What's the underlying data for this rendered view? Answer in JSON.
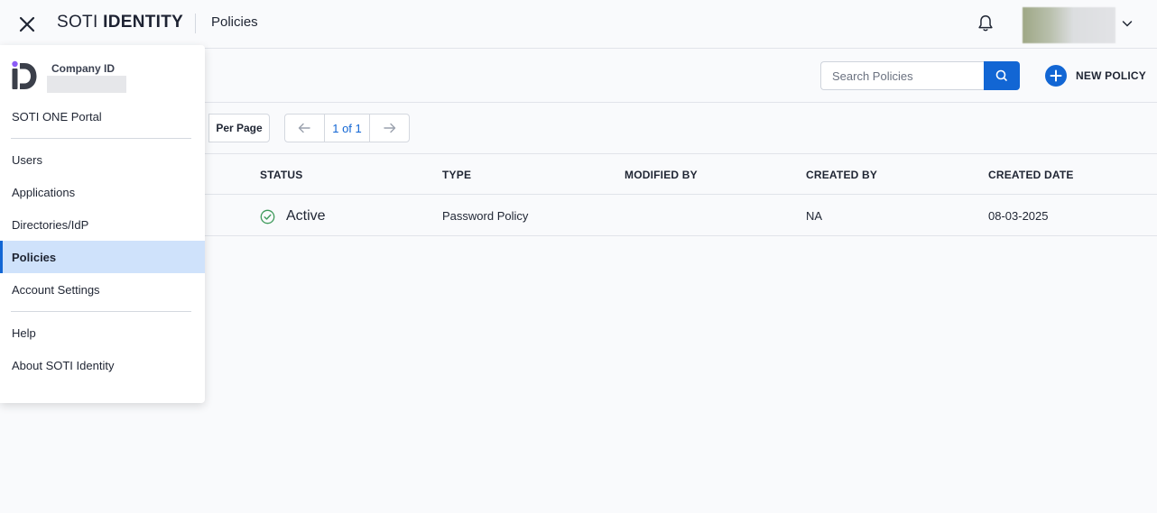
{
  "header": {
    "brand_light": "SOTI ",
    "brand_bold": "IDENTITY",
    "title": "Policies"
  },
  "toolbar": {
    "search_placeholder": "Search Policies",
    "new_policy_label": "NEW POLICY"
  },
  "pagination": {
    "per_page_label": "Per Page",
    "page_indicator": "1 of 1"
  },
  "table": {
    "columns": [
      "STATUS",
      "TYPE",
      "MODIFIED BY",
      "CREATED BY",
      "CREATED DATE"
    ],
    "rows": [
      {
        "status": "Active",
        "type": "Password Policy",
        "modified_by": "",
        "created_by": "NA",
        "created_date": "08-03-2025"
      }
    ]
  },
  "menu": {
    "company_label": "Company ID",
    "items": [
      {
        "label": "SOTI ONE Portal"
      },
      {
        "label": "Users"
      },
      {
        "label": "Applications"
      },
      {
        "label": "Directories/IdP"
      },
      {
        "label": "Policies",
        "active": true
      },
      {
        "label": "Account Settings"
      },
      {
        "label": "Help"
      },
      {
        "label": "About SOTI Identity"
      }
    ]
  },
  "colors": {
    "accent": "#1266d4",
    "active_bg": "#cfe2fb",
    "status_green": "#3e9a5b",
    "logo_purple": "#8b5cf6"
  },
  "icons": [
    "close-icon",
    "bell-icon",
    "chevron-down-icon",
    "search-icon",
    "plus-icon",
    "arrow-left-icon",
    "arrow-right-icon",
    "check-circle-icon",
    "soti-id-logo-icon"
  ]
}
